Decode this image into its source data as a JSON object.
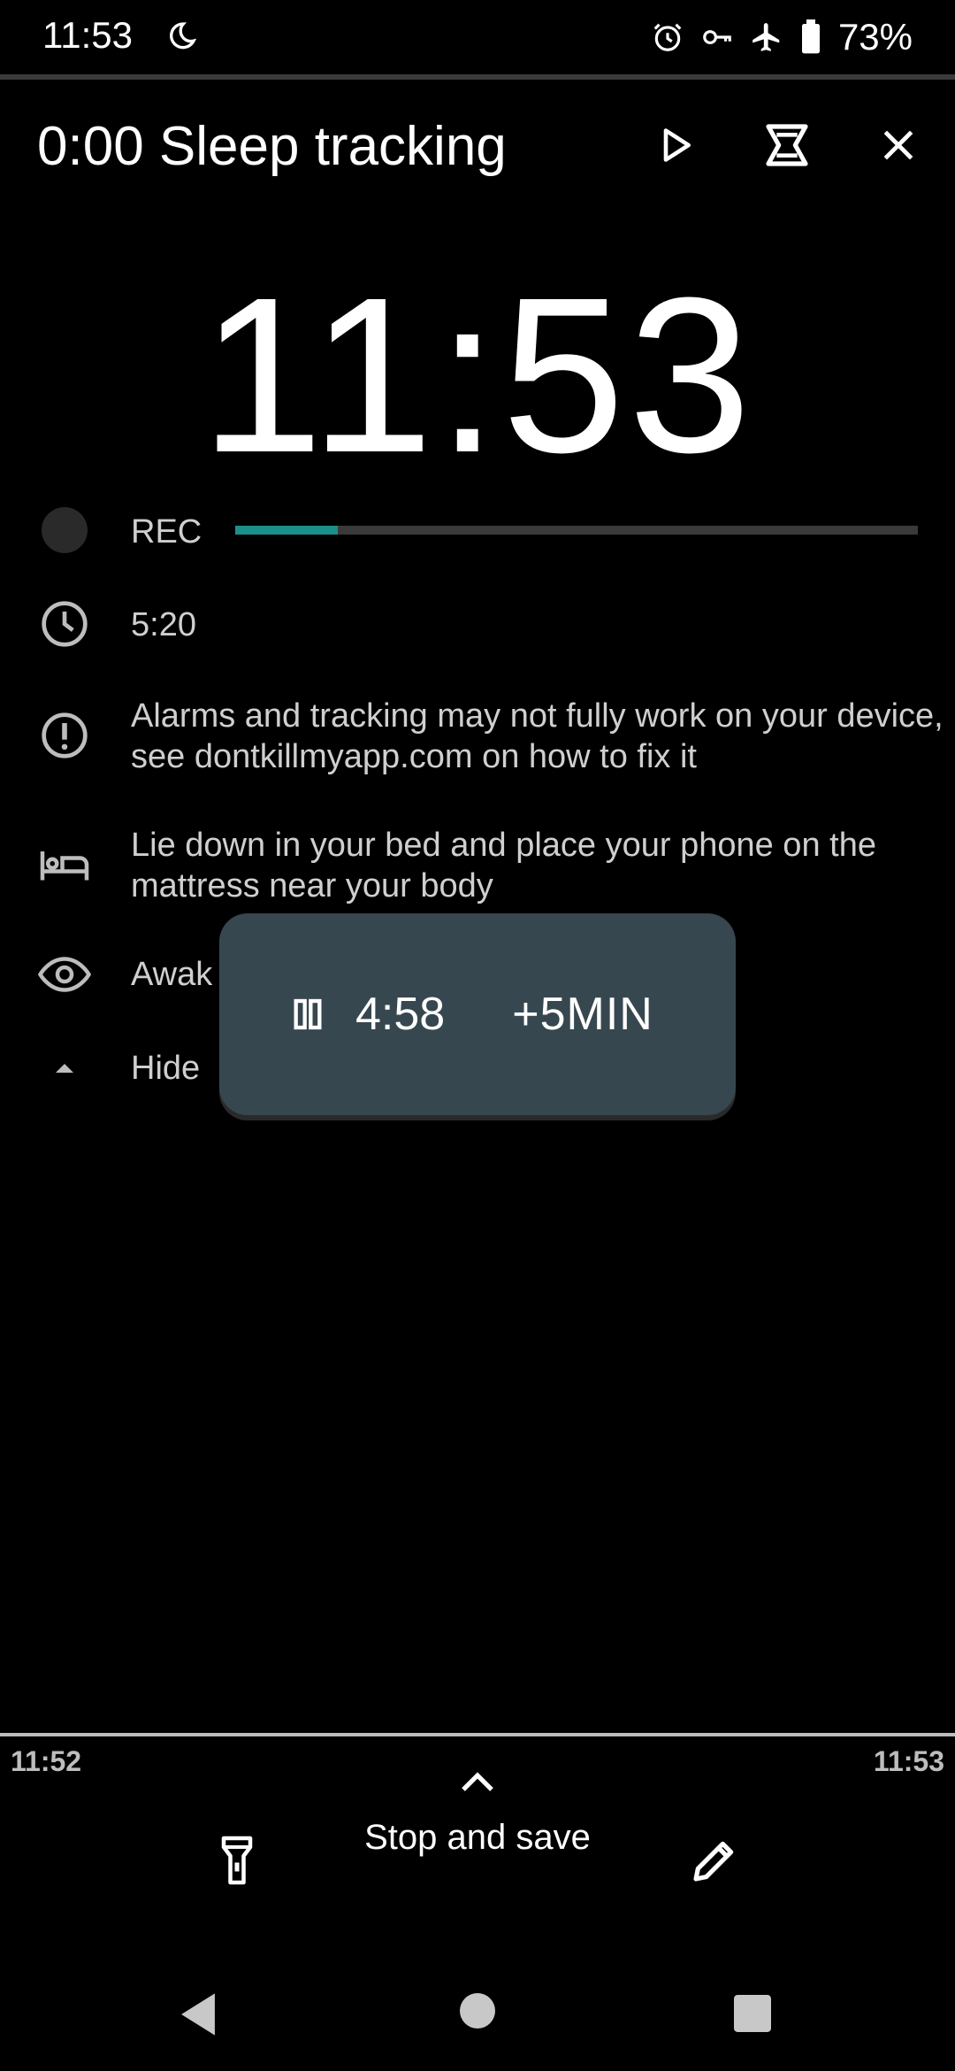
{
  "status_bar": {
    "time": "11:53",
    "battery_percent": "73%",
    "icons": [
      "moon-icon",
      "alarm-icon",
      "vpn-key-icon",
      "airplane-icon",
      "battery-icon"
    ]
  },
  "header": {
    "title": "0:00 Sleep tracking",
    "actions": [
      "play-icon",
      "lullaby-icon",
      "close-icon"
    ]
  },
  "clock": {
    "time": "11:53"
  },
  "rows": {
    "rec_label": "REC",
    "rec_progress": 0.15,
    "duration": "5:20",
    "warning": "Alarms and tracking may not fully work on your device, see dontkillmyapp.com on how to fix it",
    "tip": "Lie down in your bed and place your phone on the mattress near your body",
    "awake_label": "Awak",
    "hide_label": "Hide"
  },
  "snooze_toast": {
    "time": "4:58",
    "add_label": "+5MIN"
  },
  "timeline": {
    "start": "11:52",
    "end": "11:53"
  },
  "bottom": {
    "stop_label": "Stop and save"
  },
  "colors": {
    "accent": "#1d8f8a",
    "toast_bg": "#37474f",
    "text_secondary": "#cfcfcf"
  }
}
